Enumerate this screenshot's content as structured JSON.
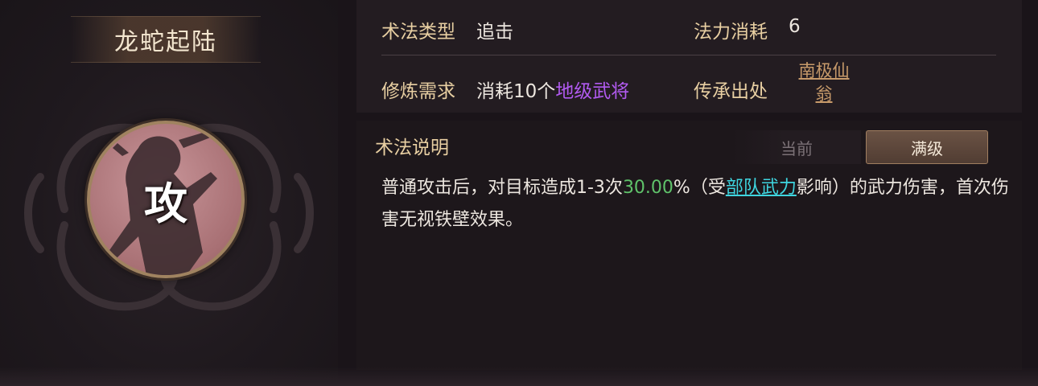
{
  "skill": {
    "name": "龙蛇起陆",
    "emblem_char": "攻"
  },
  "info": {
    "type_label": "术法类型",
    "type_value": "追击",
    "cost_label": "法力消耗",
    "cost_value": "6",
    "req_label": "修炼需求",
    "req_prefix": "消耗10个",
    "req_highlight": "地级武将",
    "source_label": "传承出处",
    "source_value": "南极仙翁"
  },
  "description": {
    "title": "术法说明",
    "tabs": {
      "current": "当前",
      "max": "满级",
      "selected": "满级"
    },
    "text_part1": "普通攻击后，对目标造成1-3次",
    "percent": "30.00",
    "text_part2": "%（受",
    "link": "部队武力",
    "text_part3": "影响）的武力伤害，首次伤害无视铁壁效果。"
  },
  "colors": {
    "label_gold": "#e8cfa2",
    "highlight_purple": "#b15af0",
    "value_green": "#5fc26a",
    "link_cyan": "#3fd6e0",
    "source_link": "#c79a6a"
  }
}
